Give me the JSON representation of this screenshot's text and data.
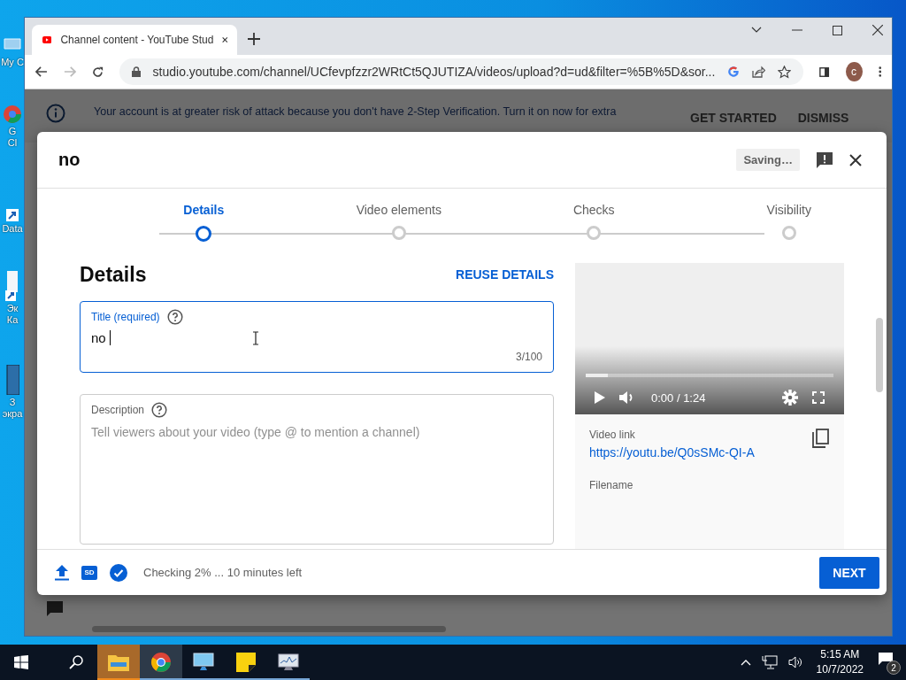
{
  "desktop": {
    "icons": [
      {
        "kind": "pc",
        "lines": [
          "My C"
        ]
      },
      {
        "kind": "chrome",
        "lines": [
          "G",
          "Cl"
        ]
      },
      {
        "kind": "shortcut",
        "lines": [
          "Data"
        ]
      },
      {
        "kind": "doc",
        "lines": [
          "Эк",
          "Ка"
        ]
      },
      {
        "kind": "film",
        "lines": [
          "З",
          "экра"
        ]
      }
    ]
  },
  "browser": {
    "tabs": [
      {
        "title": "Channel content - YouTube Stud",
        "selected": true
      }
    ],
    "address": "studio.youtube.com/channel/UCfevpfzzr2WRtCt5QJUTIZA/videos/upload?d=ud&filter=%5B%5D&sor...",
    "profile_initial": "c"
  },
  "banner": {
    "text": "Your account is at greater risk of attack because you don't have 2-Step Verification. Turn it on now for extra",
    "actions": [
      "GET STARTED",
      "DISMISS"
    ]
  },
  "dialog": {
    "title": "no",
    "status": "Saving…",
    "steps": [
      {
        "label": "Details",
        "selected": true
      },
      {
        "label": "Video elements",
        "selected": false
      },
      {
        "label": "Checks",
        "selected": false
      },
      {
        "label": "Visibility",
        "selected": false
      }
    ],
    "section_title": "Details",
    "reuse": "REUSE DETAILS",
    "title_field": {
      "label": "Title (required)",
      "value": "no",
      "count": "3/100"
    },
    "description_field": {
      "label": "Description",
      "placeholder": "Tell viewers about your video (type @ to mention a channel)"
    },
    "video": {
      "level": 0.09,
      "time": "0:00 / 1:24",
      "link_label": "Video link",
      "link": "https://youtu.be/Q0sSMc-QI-A",
      "filename_label": "Filename"
    },
    "footer": {
      "quality": "SD",
      "status": "Checking 2% ... 10 minutes left",
      "next": "NEXT"
    }
  },
  "taskbar": {
    "apps": [
      {
        "kind": "explorer",
        "selected": false,
        "attention": true
      },
      {
        "kind": "chrome",
        "selected": true,
        "attention": false
      },
      {
        "kind": "monitor",
        "selected": false,
        "attention": false
      },
      {
        "kind": "notes",
        "selected": false,
        "attention": false
      },
      {
        "kind": "perf",
        "selected": false,
        "attention": false
      }
    ],
    "time": "5:15 AM",
    "date": "10/7/2022",
    "notifications": "2"
  }
}
